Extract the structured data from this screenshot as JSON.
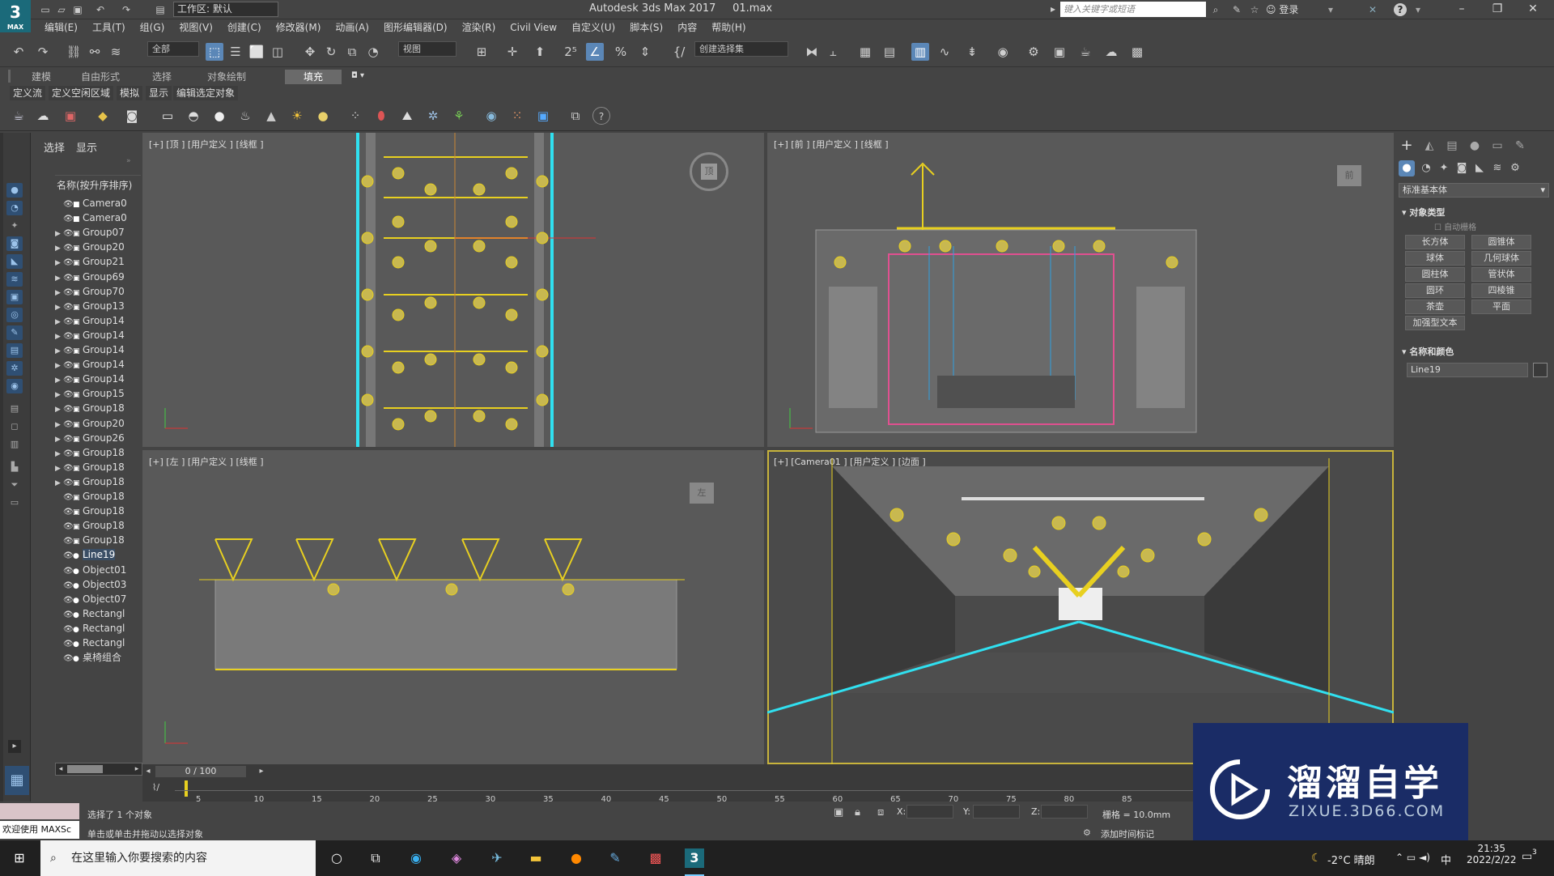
{
  "app": {
    "logo_text": "3",
    "logo_sub": "MAX",
    "workspace_label": "工作区: 默认",
    "title": "Autodesk 3ds Max 2017",
    "filename": "01.max",
    "search_placeholder": "键入关键字或短语",
    "login_label": "登录"
  },
  "menu": [
    "编辑(E)",
    "工具(T)",
    "组(G)",
    "视图(V)",
    "创建(C)",
    "修改器(M)",
    "动画(A)",
    "图形编辑器(D)",
    "渲染(R)",
    "Civil View",
    "自定义(U)",
    "脚本(S)",
    "内容",
    "帮助(H)"
  ],
  "toolbar": {
    "filter_label": "全部",
    "refcoord_label": "视图",
    "selection_set_label": "创建选择集"
  },
  "ribbon": {
    "tabs": [
      "建模",
      "自由形式",
      "选择",
      "对象绘制",
      "填充"
    ],
    "active_tab": "填充",
    "subitems": [
      "定义流",
      "定义空闲区域",
      "模拟",
      "显示",
      "编辑选定对象"
    ]
  },
  "explorer": {
    "tabs": [
      "选择",
      "显示"
    ],
    "column_header": "名称(按升序排序)",
    "items": [
      {
        "name": "Camera0",
        "type": "camera",
        "expand": false,
        "selected": false
      },
      {
        "name": "Camera0",
        "type": "camera",
        "expand": false,
        "selected": false
      },
      {
        "name": "Group07",
        "type": "group",
        "expand": true,
        "selected": false
      },
      {
        "name": "Group20",
        "type": "group",
        "expand": true,
        "selected": false
      },
      {
        "name": "Group21",
        "type": "group",
        "expand": true,
        "selected": false
      },
      {
        "name": "Group69",
        "type": "group",
        "expand": true,
        "selected": false
      },
      {
        "name": "Group70",
        "type": "group",
        "expand": true,
        "selected": false
      },
      {
        "name": "Group13",
        "type": "group",
        "expand": true,
        "selected": false
      },
      {
        "name": "Group14",
        "type": "group",
        "expand": true,
        "selected": false
      },
      {
        "name": "Group14",
        "type": "group",
        "expand": true,
        "selected": false
      },
      {
        "name": "Group14",
        "type": "group",
        "expand": true,
        "selected": false
      },
      {
        "name": "Group14",
        "type": "group",
        "expand": true,
        "selected": false
      },
      {
        "name": "Group14",
        "type": "group",
        "expand": true,
        "selected": false
      },
      {
        "name": "Group15",
        "type": "group",
        "expand": true,
        "selected": false
      },
      {
        "name": "Group18",
        "type": "group",
        "expand": true,
        "selected": false
      },
      {
        "name": "Group20",
        "type": "group",
        "expand": true,
        "selected": false
      },
      {
        "name": "Group26",
        "type": "group",
        "expand": true,
        "selected": false
      },
      {
        "name": "Group18",
        "type": "group",
        "expand": true,
        "selected": false
      },
      {
        "name": "Group18",
        "type": "group",
        "expand": true,
        "selected": false
      },
      {
        "name": "Group18",
        "type": "group",
        "expand": true,
        "selected": false
      },
      {
        "name": "Group18",
        "type": "group",
        "expand": false,
        "selected": false
      },
      {
        "name": "Group18",
        "type": "group",
        "expand": false,
        "selected": false
      },
      {
        "name": "Group18",
        "type": "group",
        "expand": false,
        "selected": false
      },
      {
        "name": "Group18",
        "type": "group",
        "expand": false,
        "selected": false
      },
      {
        "name": "Line19",
        "type": "shape",
        "expand": false,
        "selected": true
      },
      {
        "name": "Object01",
        "type": "object",
        "expand": false,
        "selected": false
      },
      {
        "name": "Object03",
        "type": "object",
        "expand": false,
        "selected": false
      },
      {
        "name": "Object07",
        "type": "object",
        "expand": false,
        "selected": false
      },
      {
        "name": "Rectangl",
        "type": "object",
        "expand": false,
        "selected": false
      },
      {
        "name": "Rectangl",
        "type": "object",
        "expand": false,
        "selected": false
      },
      {
        "name": "Rectangl",
        "type": "object",
        "expand": false,
        "selected": false
      },
      {
        "name": "桌椅组合",
        "type": "object",
        "expand": false,
        "selected": false
      }
    ]
  },
  "viewports": {
    "top": "[+] [顶 ] [用户定义 ] [线框 ]",
    "front": "[+] [前 ] [用户定义 ] [线框 ]",
    "left": "[+] [左 ] [用户定义 ] [线框 ]",
    "camera": "[+] [Camera01 ] [用户定义 ] [边面 ]",
    "viewcube_top": "顶",
    "viewcube_front": "前",
    "viewcube_left": "左"
  },
  "cmdpanel": {
    "category_dropdown": "标准基本体",
    "rollout_object_type": "对象类型",
    "autogrid_label": "自动栅格",
    "buttons": [
      "长方体",
      "圆锥体",
      "球体",
      "几何球体",
      "圆柱体",
      "管状体",
      "圆环",
      "四棱锥",
      "茶壶",
      "平面",
      "加强型文本"
    ],
    "rollout_name_color": "名称和颜色",
    "object_name": "Line19",
    "object_color": "#3a3a3a"
  },
  "timeline": {
    "frame_display": "0 / 100",
    "ticks": [
      "5",
      "10",
      "15",
      "20",
      "25",
      "30",
      "35",
      "40",
      "45",
      "50",
      "55",
      "60",
      "65",
      "70",
      "75",
      "80",
      "85"
    ]
  },
  "status": {
    "maxscript_label": "欢迎使用 MAXSc",
    "selected_msg": "选择了 1 个对象",
    "prompt_msg": "单击或单击并拖动以选择对象",
    "x_label": "X:",
    "y_label": "Y:",
    "z_label": "Z:",
    "grid_label": "栅格 = 10.0mm",
    "add_tag_label": "添加时间标记"
  },
  "watermark": {
    "brand": "溜溜自学",
    "url": "ZIXUE.3D66.COM"
  },
  "taskbar": {
    "search_placeholder": "在这里输入你要搜索的内容",
    "weather": "-2°C 晴朗",
    "ime": "中",
    "time": "21:35",
    "date": "2022/2/22",
    "notif_count": "3"
  },
  "colors": {
    "accent_blue": "#5b87b7",
    "wire_yellow": "#e8d020",
    "wire_cyan": "#30e0f0",
    "wire_pink": "#e05090",
    "viewport_bg": "#595959",
    "watermark_bg": "#1a2c66"
  }
}
